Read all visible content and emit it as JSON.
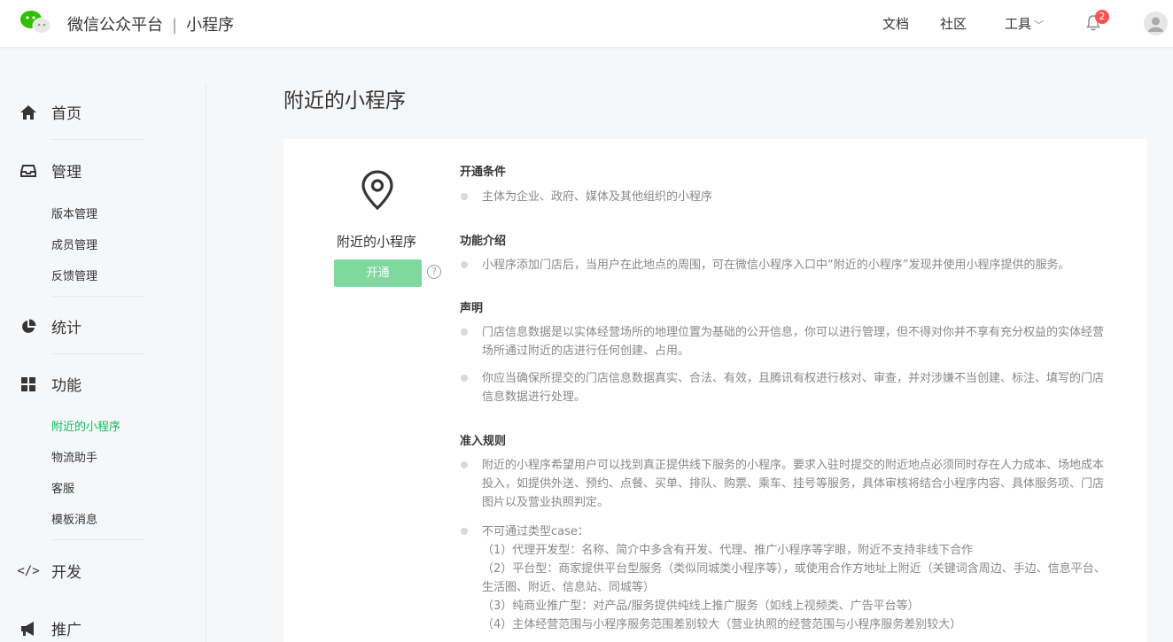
{
  "header": {
    "brand": "微信公众平台",
    "separator": "|",
    "product": "小程序",
    "nav_docs": "文档",
    "nav_community": "社区",
    "nav_tools": "工具",
    "notification_count": "2"
  },
  "sidebar": {
    "home": "首页",
    "manage": "管理",
    "manage_items": [
      "版本管理",
      "成员管理",
      "反馈管理"
    ],
    "stats": "统计",
    "features": "功能",
    "feature_items": [
      "附近的小程序",
      "物流助手",
      "客服",
      "模板消息"
    ],
    "develop": "开发",
    "promote": "推广"
  },
  "main": {
    "title": "附近的小程序",
    "feature_name": "附近的小程序",
    "open_button": "开通",
    "help": "?",
    "conditions_title": "开通条件",
    "conditions": "主体为企业、政府、媒体及其他组织的小程序",
    "intro_title": "功能介绍",
    "intro": "小程序添加门店后，当用户在此地点的周围，可在微信小程序入口中“附近的小程序”发现并使用小程序提供的服务。",
    "statement_title": "声明",
    "statement_1": "门店信息数据是以实体经营场所的地理位置为基础的公开信息，你可以进行管理，但不得对你并不享有充分权益的实体经营场所通过附近的店进行任何创建、占用。",
    "statement_2": "你应当确保所提交的门店信息数据真实、合法、有效，且腾讯有权进行核对、审查，并对涉嫌不当创建、标注、填写的门店信息数据进行处理。",
    "rules_title": "准入规则",
    "rules_1": "附近的小程序希望用户可以找到真正提供线下服务的小程序。要求入驻时提交的附近地点必须同时存在人力成本、场地成本投入，如提供外送、预约、点餐、买单、排队、购票、乘车、挂号等服务，具体审核将结合小程序内容、具体服务项、门店图片以及营业执照判定。",
    "rules_2_title": "不可通过类型case：",
    "rules_2_items": [
      "（1）代理开发型：名称、简介中多含有开发、代理、推广小程序等字眼，附近不支持非线下合作",
      "（2）平台型：商家提供平台型服务（类似同城类小程序等），或使用合作方地址上附近（关键词含周边、手边、信息平台、生活圈、附近、信息站、同城等）",
      "（3）纯商业推广型：对产品/服务提供纯线上推广服务（如线上视频类、广告平台等）",
      "（4）主体经营范围与小程序服务范围差别较大（营业执照的经营范围与小程序服务差别较大）"
    ]
  },
  "colors": {
    "accent": "#07c160",
    "button_disabled": "#7fd89e",
    "badge": "#fa5151"
  }
}
